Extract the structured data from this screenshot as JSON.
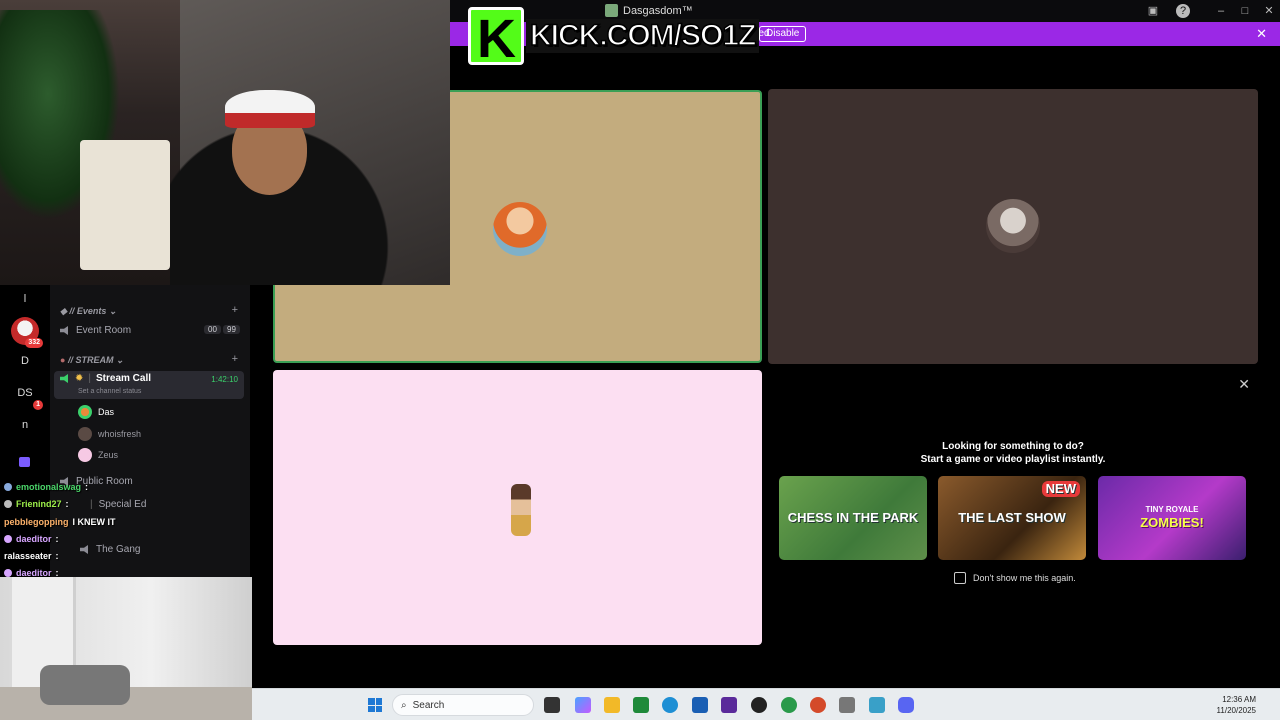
{
  "window": {
    "title": "Dasgasdom™"
  },
  "banner": {
    "text": "uncated.",
    "disable_label": "Disable",
    "close": "✕"
  },
  "kick_overlay": {
    "url": "KICK.COM/SO1Z"
  },
  "activity_panel": {
    "title_line1": "Looking for something to do?",
    "title_line2": "Start a game or video playlist instantly.",
    "games": [
      {
        "name": "CHESS IN THE PARK"
      },
      {
        "name": "THE LAST SHOW",
        "badge": "NEW"
      },
      {
        "name": "ZOMBIES!",
        "subtitle": "TINY ROYALE"
      }
    ],
    "dont_show": "Don't show me this again."
  },
  "guilds": [
    {
      "label": "l"
    },
    {
      "label": "",
      "badge": "332"
    },
    {
      "label": "D"
    },
    {
      "label": "DS",
      "badge": "1"
    },
    {
      "label": "n"
    }
  ],
  "channels": {
    "events_category": "// Events",
    "event_room": {
      "name": "Event Room",
      "count_a": "00",
      "count_b": "99"
    },
    "stream_category": "// STREAM",
    "stream_call": {
      "name": "Stream Call",
      "timer": "1:42:10",
      "status": "Set a channel status"
    },
    "users": [
      "Das",
      "whoisfresh",
      "Zeus"
    ],
    "public_room": "Public Room",
    "special_ed": "Special Ed",
    "the_gang": "The Gang"
  },
  "chat": [
    {
      "user": "emotionalswag",
      "text": ":",
      "color": "#4bd66a"
    },
    {
      "user": "Frienind27",
      "text": ":",
      "color": "#9ef04a"
    },
    {
      "user": "pebblegopping",
      "text": "I KNEW IT",
      "color": "#ffffff"
    },
    {
      "user": "daeditor",
      "text": ":",
      "color": "#d7a6ff"
    },
    {
      "user": "ralasseater",
      "text": ":",
      "color": "#ffffff"
    },
    {
      "user": "daeditor",
      "text": ":",
      "color": "#d7a6ff"
    }
  ],
  "taskbar": {
    "search_placeholder": "Search",
    "time": "12:36 AM",
    "date": "11/20/2025"
  },
  "colors": {
    "banner": "#9b28e6",
    "kick_green": "#53fc18",
    "tile_speaking_border": "#3b9f55"
  }
}
